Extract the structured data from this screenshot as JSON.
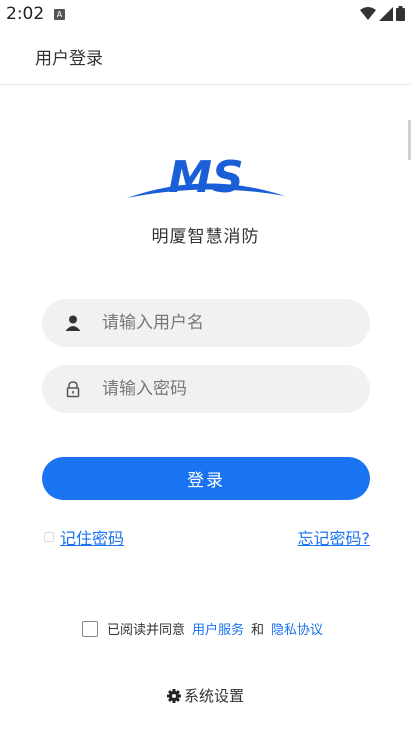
{
  "status_bar": {
    "time": "2:02",
    "notification_badge": "A"
  },
  "app_bar": {
    "title": "用户登录"
  },
  "logo": {
    "text": "MS",
    "color": "#1a5fd8"
  },
  "brand": {
    "name": "明厦智慧消防"
  },
  "login_form": {
    "username_placeholder": "请输入用户名",
    "password_placeholder": "请输入密码",
    "login_label": "登录",
    "remember_label": "记住密码",
    "forgot_label": "忘记密码?"
  },
  "agreement": {
    "prefix": "已阅读并同意",
    "service_link": "用户服务",
    "conjunction": "和",
    "privacy_link": "隐私协议"
  },
  "settings": {
    "label": "系统设置",
    "icon": "gear-icon"
  },
  "colors": {
    "accent": "#1a73f0",
    "field_bg": "#f1f1f1"
  }
}
